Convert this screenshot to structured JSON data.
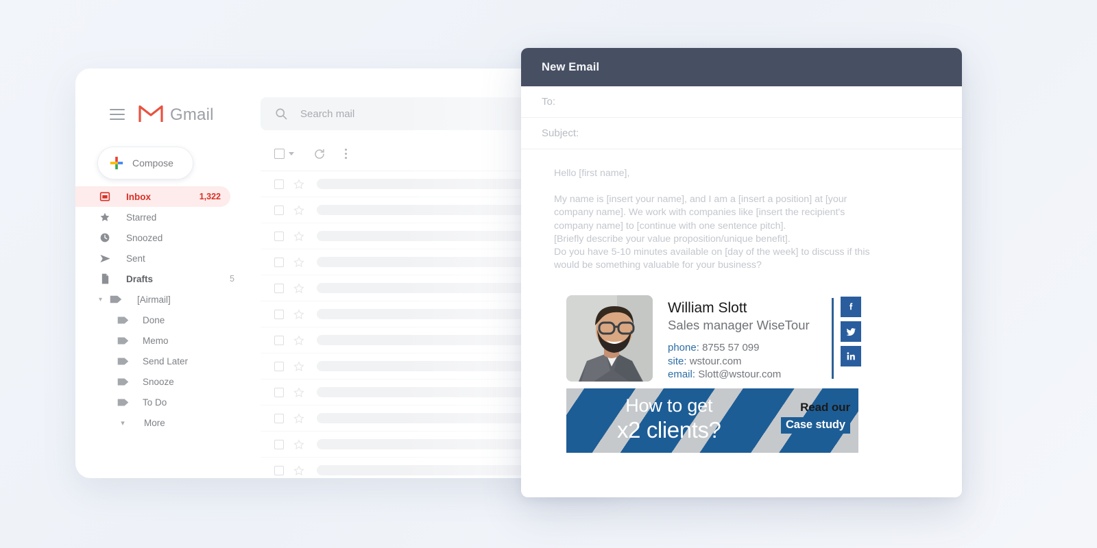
{
  "app": {
    "background_color": "#f1f4f9",
    "brand": "Gmail"
  },
  "gmail": {
    "wordmark": "Gmail",
    "search": {
      "placeholder": "Search mail",
      "value": "",
      "icon": "search-icon"
    },
    "menu_icon": "hamburger-icon",
    "compose": {
      "label": "Compose",
      "icon": "plus-icon"
    },
    "nav_items": [
      {
        "label": "Inbox",
        "count": "1,322",
        "icon": "inbox-icon",
        "active": true,
        "accent": "#d93025"
      },
      {
        "label": "Starred",
        "count": "",
        "icon": "star-icon",
        "active": false
      },
      {
        "label": "Snoozed",
        "count": "",
        "icon": "clock-icon",
        "active": false
      },
      {
        "label": "Sent",
        "count": "",
        "icon": "send-icon",
        "active": false
      },
      {
        "label": "Drafts",
        "count": "5",
        "icon": "draft-icon",
        "active": false
      },
      {
        "label": "[Airmail]",
        "count": "",
        "icon": "label-icon",
        "active": false,
        "expanded": true
      },
      {
        "label": "Done",
        "count": "",
        "icon": "label-icon",
        "sub": true
      },
      {
        "label": "Memo",
        "count": "",
        "icon": "label-icon",
        "sub": true
      },
      {
        "label": "Send Later",
        "count": "",
        "icon": "label-icon",
        "sub": true
      },
      {
        "label": "Snooze",
        "count": "",
        "icon": "label-icon",
        "sub": true
      },
      {
        "label": "To Do",
        "count": "",
        "icon": "label-icon",
        "sub": true
      },
      {
        "label": "More",
        "count": "",
        "icon": "chevron-down-icon",
        "sub": true
      }
    ],
    "toolbar": {
      "select_all_icon": "checkbox-icon",
      "select_all_caret_icon": "chevron-down-icon",
      "refresh_icon": "refresh-icon",
      "more_icon": "more-vertical-icon"
    },
    "mail_rows_count": 12
  },
  "compose": {
    "title": "New Email",
    "header_color": "#474f63",
    "fields": {
      "to_label": "To:",
      "to_value": "",
      "subject_label": "Subject:",
      "subject_value": ""
    },
    "body": {
      "greeting": "Hello [first name],",
      "paragraph": "My name is [insert your name], and I am a [insert a position] at [your\ncompany name]. We work with companies like [insert the recipient's\ncompany name] to [continue with one sentence pitch].\n[Briefly describe your value proposition/unique benefit].\nDo you have 5-10 minutes available on [day of the week] to discuss if this\nwould be something valuable for your business?"
    },
    "signature": {
      "photo_alt": "portrait-photo",
      "name": "William Slott",
      "role": "Sales manager WiseTour",
      "contacts": [
        {
          "key": "phone:",
          "value": "8755 57 099"
        },
        {
          "key": "site:",
          "value": "wstour.com"
        },
        {
          "key": "email:",
          "value": "Slott@wstour.com"
        }
      ],
      "accent_color": "#2e6da4",
      "social": [
        {
          "name": "facebook-icon",
          "glyph": "f"
        },
        {
          "name": "twitter-icon",
          "glyph": "t"
        },
        {
          "name": "linkedin-icon",
          "glyph": "in"
        }
      ],
      "banner": {
        "line1": "How to get",
        "line2": "x2 clients?",
        "read_label": "Read our",
        "cta_label": "Case study",
        "bg_color": "#1d5d96",
        "stripe_color": "#c5c9cc"
      }
    }
  }
}
